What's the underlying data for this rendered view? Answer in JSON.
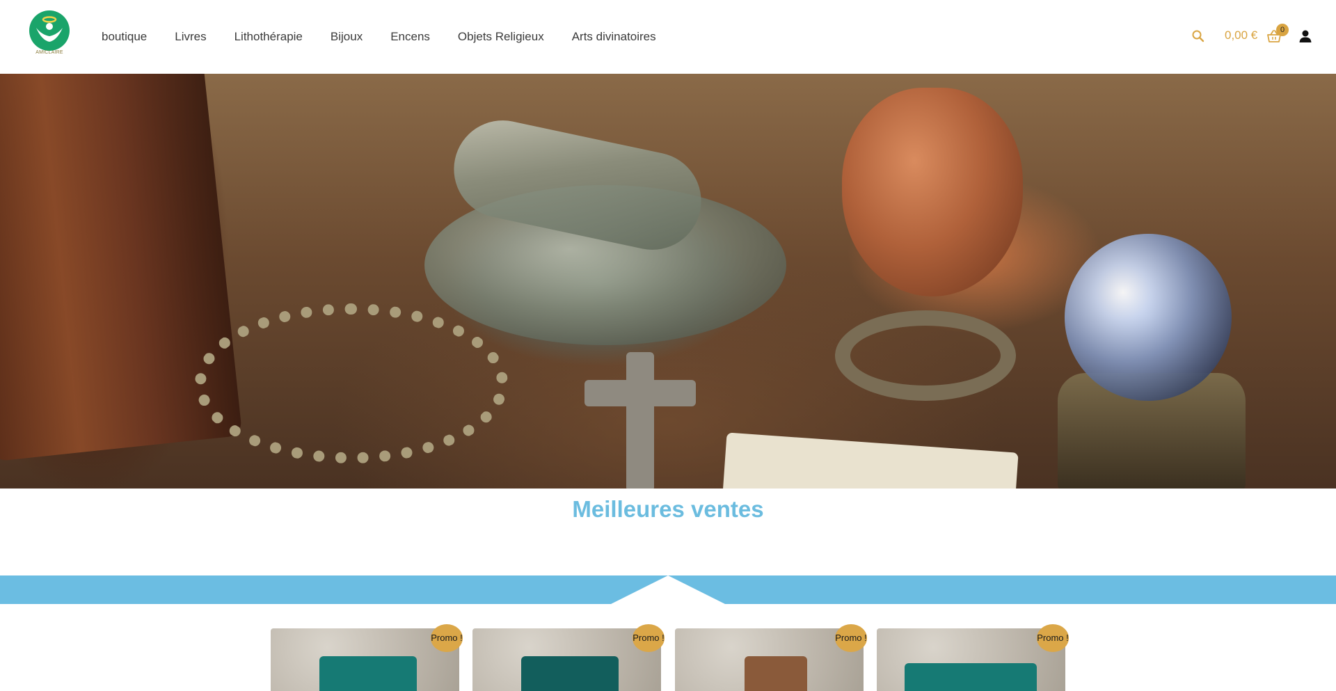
{
  "brand": {
    "logo_text": "AMICLAIRE"
  },
  "nav": {
    "items": [
      "boutique",
      "Livres",
      "Lithothérapie",
      "Bijoux",
      "Encens",
      "Objets Religieux",
      "Arts divinatoires"
    ]
  },
  "header": {
    "cart_total": "0,00 €",
    "cart_count": "0",
    "icons": {
      "search": "search-icon",
      "cart": "basket-icon",
      "account": "user-icon"
    }
  },
  "section": {
    "title": "Meilleures ventes"
  },
  "products": [
    {
      "badge": "Promo !",
      "item_color": "#167a74"
    },
    {
      "badge": "Promo !",
      "item_color": "#125e5c"
    },
    {
      "badge": "Promo !",
      "item_color": "#8a5a3a"
    },
    {
      "badge": "Promo !",
      "item_color": "#167a74"
    }
  ],
  "colors": {
    "accent_gold": "#d9a441",
    "section_blue": "#6bbde2",
    "title_blue": "#6bbcdf",
    "logo_green": "#1aa46a"
  }
}
